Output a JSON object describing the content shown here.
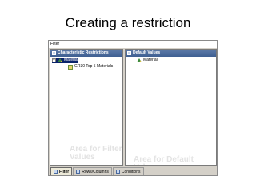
{
  "slide": {
    "title": "Creating a restriction"
  },
  "window": {
    "title": "Filter"
  },
  "left_pane": {
    "header": "Characteristic Restrictions",
    "tree": [
      {
        "label": "Material",
        "expander": "−"
      },
      {
        "label": "GR30 Top 5 Materials"
      }
    ],
    "watermark_line1": "Area for Filter",
    "watermark_line2": "Values"
  },
  "right_pane": {
    "header": "Default Values",
    "tree": [
      {
        "label": "Material"
      }
    ],
    "watermark": "Area for Default Values"
  },
  "tabs": [
    {
      "label": "Filter",
      "active": true
    },
    {
      "label": "Rows/Columns",
      "active": false
    },
    {
      "label": "Conditions",
      "active": false
    }
  ]
}
